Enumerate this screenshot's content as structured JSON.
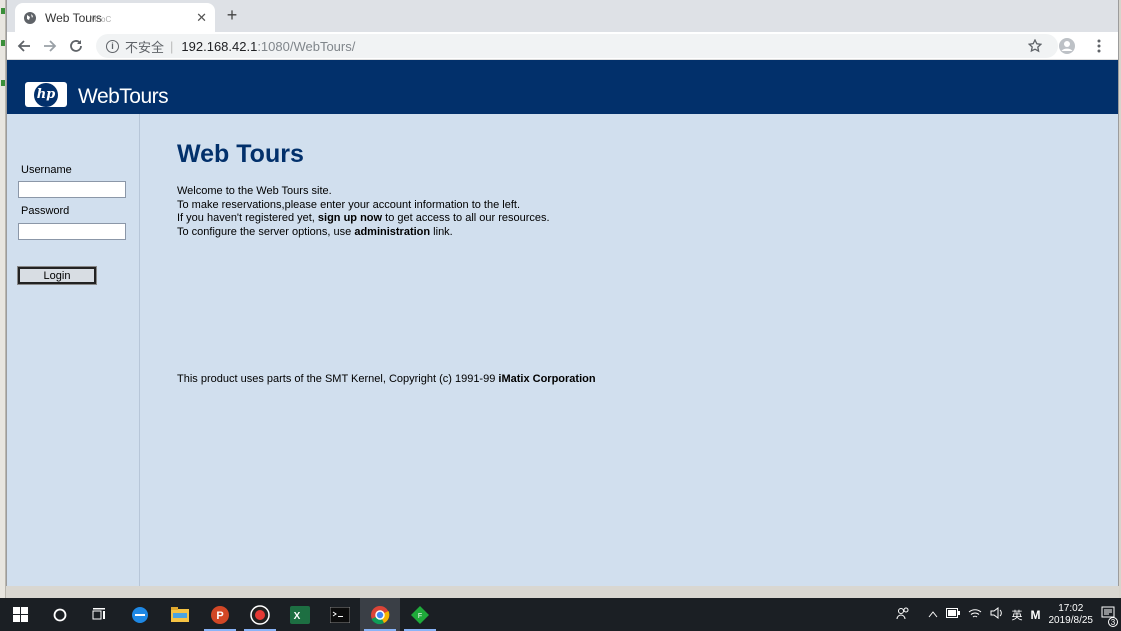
{
  "browser": {
    "tab_title": "Web Tours",
    "tab_suffix": "MooC",
    "security_label": "不安全",
    "url_host": "192.168.42.1",
    "url_path": ":1080/WebTours/"
  },
  "header": {
    "logo_text": "hp",
    "brand": "WebTours"
  },
  "sidebar": {
    "username_label": "Username",
    "password_label": "Password",
    "login_button": "Login"
  },
  "main": {
    "title": "Web Tours",
    "line1": "Welcome to the Web Tours site.",
    "line2": "To make reservations,please enter your account information to the left.",
    "line3_pre": "If you haven't registered yet, ",
    "line3_link": "sign up now",
    "line3_post": " to get access to all our resources.",
    "line4_pre": "To configure the server options, use ",
    "line4_link": "administration",
    "line4_post": " link.",
    "copyright_pre": "This product uses parts of the SMT Kernel, Copyright (c) 1991-99 ",
    "copyright_link": "iMatix Corporation"
  },
  "taskbar": {
    "ime": "英",
    "time": "17:02",
    "date": "2019/8/25",
    "notif_count": "3",
    "apps": [
      "windows-start",
      "cortana",
      "task-view",
      "edge",
      "file-explorer",
      "powerpoint",
      "recorder",
      "excel",
      "terminal",
      "chrome",
      "green-app"
    ]
  },
  "colors": {
    "header_bg": "#02306b",
    "page_bg": "#d1dfee",
    "title": "#02306b"
  }
}
